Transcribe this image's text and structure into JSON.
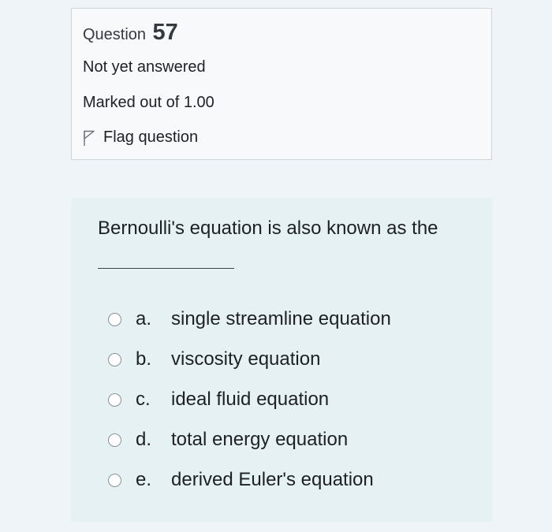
{
  "question_info": {
    "label": "Question",
    "number": "57",
    "status": "Not yet answered",
    "marks": "Marked out of 1.00",
    "flag_label": "Flag question"
  },
  "question": {
    "text": "Bernoulli's equation is also known as the",
    "answers": [
      {
        "letter": "a.",
        "text": "single streamline equation"
      },
      {
        "letter": "b.",
        "text": "viscosity equation"
      },
      {
        "letter": "c.",
        "text": "ideal fluid equation"
      },
      {
        "letter": "d.",
        "text": "total energy equation"
      },
      {
        "letter": "e.",
        "text": "derived Euler's equation"
      }
    ]
  },
  "colors": {
    "page_background": "#eef4f8",
    "info_background": "#f8f9fa",
    "content_background": "#e6f1f4",
    "text": "#1d2125"
  }
}
